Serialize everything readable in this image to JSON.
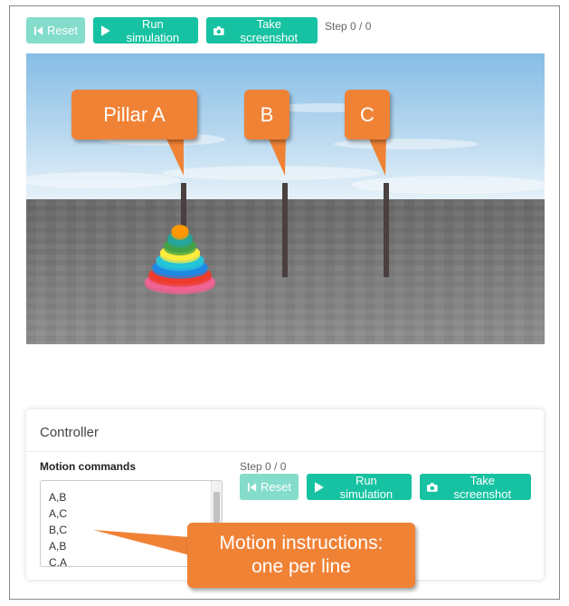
{
  "toolbar": {
    "reset_label": "Reset",
    "run_label": "Run simulation",
    "screenshot_label": "Take screenshot",
    "step_text": "Step 0 / 0"
  },
  "scene": {
    "callouts": {
      "pillar_a": "Pillar A",
      "pillar_b": "B",
      "pillar_c": "C"
    },
    "disk_colors": [
      "#f06292",
      "#ef3b2c",
      "#1e88e5",
      "#26c6da",
      "#ffeb3b",
      "#43a047",
      "#26a69a",
      "#ff9800"
    ]
  },
  "controller": {
    "title": "Controller",
    "motion_label": "Motion commands",
    "commands": [
      "A,B",
      "A,C",
      "B,C",
      "A,B",
      "C,A"
    ],
    "step_text": "Step 0 / 0",
    "reset_label": "Reset",
    "run_label": "Run simulation",
    "screenshot_label": "Take screenshot"
  },
  "annotation": {
    "line1": "Motion instructions:",
    "line2": "one per line"
  },
  "colors": {
    "accent": "#16c2a1",
    "accent_disabled": "#84dccb",
    "callout": "#f08236"
  }
}
